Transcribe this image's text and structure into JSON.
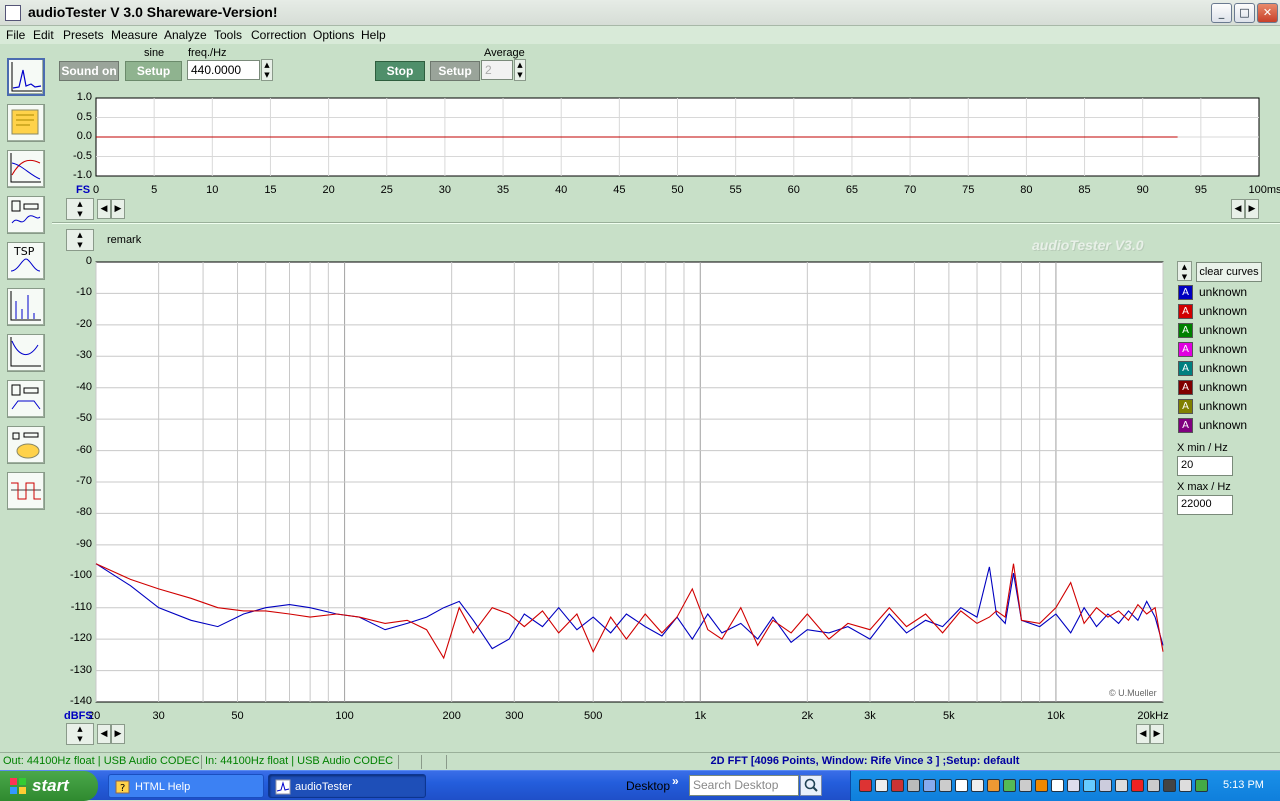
{
  "window": {
    "title": "audioTester  V 3.0 Shareware-Version!",
    "minimize": "_",
    "maximize": "□",
    "close": "✕"
  },
  "menu": [
    "File",
    "Edit",
    "Presets",
    "Measure",
    "Analyze",
    "Tools",
    "Correction",
    "Options",
    "Help"
  ],
  "toolbar": {
    "sound_on": "Sound on",
    "generator_mode": "sine",
    "setup1": "Setup",
    "freq_label": "freq./Hz",
    "freq_value": "440.0000",
    "stop": "Stop",
    "setup2": "Setup",
    "average_label": "Average",
    "average_value": "2"
  },
  "scope": {
    "y_ticks": [
      "1.0",
      "0.5",
      "0.0",
      "-0.5",
      "-1.0"
    ],
    "x_ticks": [
      "0",
      "5",
      "10",
      "15",
      "20",
      "25",
      "30",
      "35",
      "40",
      "45",
      "50",
      "55",
      "60",
      "65",
      "70",
      "75",
      "80",
      "85",
      "90",
      "95",
      "100ms"
    ],
    "fs_label": "FS"
  },
  "spectrum": {
    "remark": "remark",
    "watermark": "audioTester  V3.0",
    "credit": "© U.Mueller",
    "unit_label": "dBFS",
    "clear_curves": "clear curves",
    "curves": [
      {
        "label": "unknown",
        "color": "#0000c0",
        "mark": "A"
      },
      {
        "label": "unknown",
        "color": "#d00000",
        "mark": "A"
      },
      {
        "label": "unknown",
        "color": "#008000",
        "mark": "A"
      },
      {
        "label": "unknown",
        "color": "#e000e0",
        "mark": "A"
      },
      {
        "label": "unknown",
        "color": "#008080",
        "mark": "A"
      },
      {
        "label": "unknown",
        "color": "#800000",
        "mark": "A"
      },
      {
        "label": "unknown",
        "color": "#808000",
        "mark": "A"
      },
      {
        "label": "unknown",
        "color": "#800080",
        "mark": "A"
      }
    ],
    "xmin_label": "X min / Hz",
    "xmin_value": "20",
    "xmax_label": "X max / Hz",
    "xmax_value": "22000"
  },
  "statusbar": {
    "out": "Out: 44100Hz float  | USB Audio CODEC",
    "in": "In: 44100Hz float  | USB Audio CODEC",
    "fft": "2D FFT [4096 Points, Window: Rife Vince 3 ]  ;Setup:  default"
  },
  "taskbar": {
    "start": "start",
    "tasks": [
      "HTML Help",
      "audioTester"
    ],
    "desktop": "Desktop",
    "search_placeholder": "Search Desktop",
    "clock": "5:13 PM"
  },
  "chart_data": [
    {
      "type": "line",
      "title": "",
      "xlabel": "",
      "ylabel": "FS",
      "xlim": [
        0,
        100
      ],
      "ylim": [
        -1.0,
        1.0
      ],
      "series": [
        {
          "color": "#c00000",
          "x": [
            0,
            93
          ],
          "y": [
            0.0,
            0.0
          ]
        }
      ]
    },
    {
      "type": "line",
      "xscale": "log",
      "xlim": [
        20,
        20000
      ],
      "ylim": [
        -140,
        0
      ],
      "x_tick_labels": [
        "20",
        "30",
        "50",
        "100",
        "200",
        "300",
        "500",
        "1k",
        "2k",
        "3k",
        "5k",
        "10k",
        "20kHz"
      ],
      "y_tick_labels": [
        "0",
        "-10",
        "-20",
        "-30",
        "-40",
        "-50",
        "-60",
        "-70",
        "-80",
        "-90",
        "-100",
        "-110",
        "-120",
        "-130",
        "-140"
      ],
      "ylabel": "dBFS",
      "series": [
        {
          "color": "#0000c0",
          "x": [
            20,
            25,
            30,
            37,
            44,
            52,
            60,
            70,
            80,
            95,
            110,
            130,
            150,
            170,
            190,
            210,
            230,
            260,
            290,
            320,
            360,
            400,
            450,
            500,
            560,
            620,
            700,
            780,
            860,
            950,
            1050,
            1150,
            1300,
            1450,
            1600,
            1800,
            2000,
            2300,
            2600,
            3000,
            3400,
            3800,
            4300,
            4800,
            5400,
            6000,
            6500,
            6800,
            7200,
            7600,
            8000,
            9000,
            10000,
            11000,
            12000,
            13000,
            14000,
            15000,
            16000,
            17000,
            18000,
            19000,
            20000
          ],
          "y": [
            -96,
            -103,
            -110,
            -114,
            -116,
            -112,
            -110,
            -109,
            -110,
            -112,
            -113,
            -117,
            -115,
            -113,
            -110,
            -108,
            -114,
            -123,
            -120,
            -112,
            -116,
            -110,
            -117,
            -113,
            -118,
            -112,
            -116,
            -119,
            -113,
            -120,
            -112,
            -118,
            -115,
            -120,
            -113,
            -121,
            -117,
            -118,
            -116,
            -120,
            -112,
            -118,
            -114,
            -116,
            -110,
            -113,
            -97,
            -112,
            -115,
            -99,
            -114,
            -116,
            -112,
            -118,
            -110,
            -116,
            -112,
            -115,
            -111,
            -114,
            -108,
            -113,
            -122
          ]
        },
        {
          "color": "#d00000",
          "x": [
            20,
            25,
            30,
            37,
            44,
            52,
            60,
            70,
            80,
            95,
            110,
            130,
            150,
            170,
            190,
            210,
            230,
            260,
            290,
            320,
            360,
            400,
            450,
            500,
            560,
            620,
            700,
            780,
            860,
            950,
            1050,
            1150,
            1300,
            1450,
            1600,
            1800,
            2000,
            2300,
            2600,
            3000,
            3400,
            3800,
            4300,
            4800,
            5400,
            6000,
            6500,
            6800,
            7200,
            7600,
            8000,
            9000,
            10000,
            11000,
            12000,
            13000,
            14000,
            15000,
            16000,
            17000,
            18000,
            19000,
            20000
          ],
          "y": [
            -96,
            -101,
            -104,
            -107,
            -110,
            -111,
            -111,
            -112,
            -113,
            -112,
            -113,
            -115,
            -114,
            -117,
            -126,
            -110,
            -118,
            -110,
            -112,
            -116,
            -111,
            -118,
            -112,
            -124,
            -113,
            -120,
            -112,
            -118,
            -113,
            -104,
            -117,
            -120,
            -110,
            -122,
            -114,
            -118,
            -112,
            -120,
            -115,
            -117,
            -110,
            -116,
            -112,
            -118,
            -111,
            -115,
            -113,
            -111,
            -113,
            -96,
            -114,
            -115,
            -110,
            -102,
            -115,
            -110,
            -113,
            -111,
            -114,
            -109,
            -112,
            -110,
            -124
          ]
        }
      ]
    }
  ]
}
